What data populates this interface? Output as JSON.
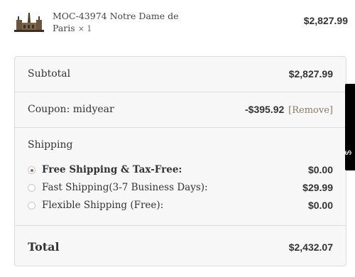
{
  "product": {
    "name": "MOC-43974 Notre Dame de Paris",
    "quantity": "× 1",
    "price": "$2,827.99"
  },
  "summary": {
    "subtotal_label": "Subtotal",
    "subtotal_value": "$2,827.99",
    "coupon_label": "Coupon: midyear",
    "coupon_value": "-$395.92",
    "coupon_remove": "[Remove]",
    "shipping_label": "Shipping",
    "shipping_options": [
      {
        "label": "Free Shipping & Tax-Free:",
        "price": "$0.00",
        "selected": true
      },
      {
        "label": "Fast Shipping(3-7 Business Days):",
        "price": "$29.99",
        "selected": false
      },
      {
        "label": "Flexible Shipping (Free):",
        "price": "$0.00",
        "selected": false
      }
    ],
    "total_label": "Total",
    "total_value": "$2,432.07"
  },
  "side_tab": {
    "label": "$"
  },
  "colors": {
    "accent": "#a0683a",
    "border": "#dcdcdc",
    "panel": "#f7f7f7"
  }
}
